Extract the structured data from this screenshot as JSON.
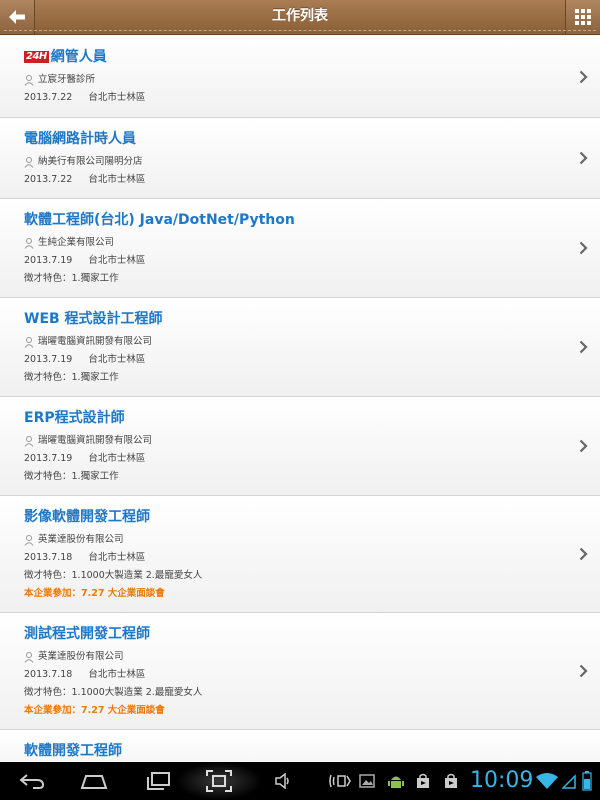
{
  "header": {
    "title": "工作列表",
    "back_icon": "back-arrow-icon",
    "menu_icon": "grid-menu-icon"
  },
  "badge": {
    "text": "24H"
  },
  "jobs": [
    {
      "title": "網管人員",
      "company": "立宸牙醫診所",
      "date": "2013.7.22",
      "location": "台北市士林區",
      "has_badge": true
    },
    {
      "title": "電腦網路計時人員",
      "company": "納美行有限公司陽明分店",
      "date": "2013.7.22",
      "location": "台北市士林區"
    },
    {
      "title": "軟體工程師(台北) Java/DotNet/Python",
      "company": "生純企業有限公司",
      "date": "2013.7.19",
      "location": "台北市士林區",
      "feature": "徵才特色：1.獨家工作"
    },
    {
      "title": "WEB 程式設計工程師",
      "company": "瑞曜電腦資訊開發有限公司",
      "date": "2013.7.19",
      "location": "台北市士林區",
      "feature": "徵才特色：1.獨家工作"
    },
    {
      "title": "ERP程式設計師",
      "company": "瑞曜電腦資訊開發有限公司",
      "date": "2013.7.19",
      "location": "台北市士林區",
      "feature": "徵才特色：1.獨家工作"
    },
    {
      "title": "影像軟體開發工程師",
      "company": "英業達股份有限公司",
      "date": "2013.7.18",
      "location": "台北市士林區",
      "feature": "徵才特色：1.1000大製造業 2.最寵愛女人",
      "fair": "本企業參加：7.27 大企業面談會"
    },
    {
      "title": "測試程式開發工程師",
      "company": "英業達股份有限公司",
      "date": "2013.7.18",
      "location": "台北市士林區",
      "feature": "徵才特色：1.1000大製造業 2.最寵愛女人",
      "fair": "本企業參加：7.27 大企業面談會"
    },
    {
      "title": "軟體開發工程師"
    }
  ],
  "statusbar": {
    "time": "10:09",
    "clock_color": "#38b6e8",
    "nav_icons": [
      "back-nav-icon",
      "home-nav-icon",
      "recent-apps-icon",
      "screenshot-icon",
      "volume-icon"
    ],
    "status_icons": [
      "screen-mirror-icon",
      "gallery-icon",
      "android-debug-icon",
      "shop-icon",
      "shop-icon",
      "wifi-icon",
      "signal-icon",
      "battery-icon"
    ]
  },
  "colors": {
    "header": "#8a6038",
    "title_link": "#1e78c8",
    "fair_text": "#f07800"
  }
}
